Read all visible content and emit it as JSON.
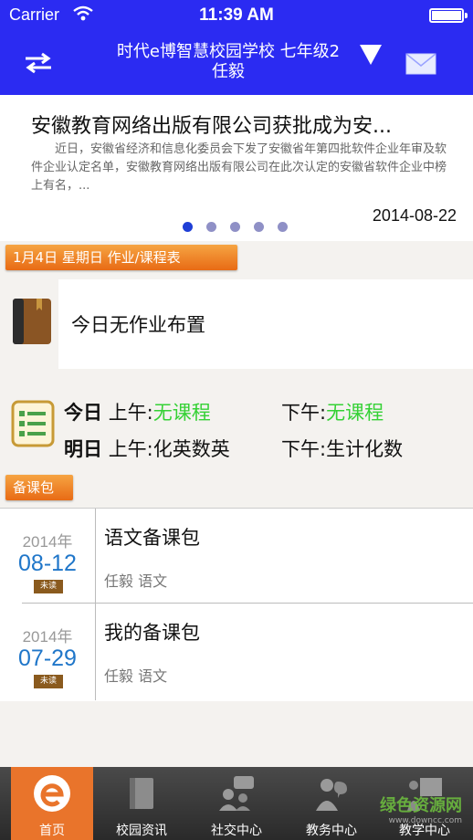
{
  "status_bar": {
    "carrier": "Carrier",
    "time": "11:39 AM"
  },
  "nav": {
    "title_line1": "时代e博智慧校园学校 七年级2",
    "title_line2": "任毅",
    "icons": [
      "switch-icon",
      "dropdown-triangle-icon",
      "mail-icon"
    ]
  },
  "news": {
    "title": "安徽教育网络出版有限公司获批成为安...",
    "body": "近日，安徽省经济和信息化委员会下发了安徽省年第四批软件企业年审及软件企业认定名单，安徽教育网络出版有限公司在此次认定的安徽省软件企业中榜上有名，...",
    "date": "2014-08-22",
    "page_count": 5,
    "active_page": 1
  },
  "schedule_tab": {
    "label": "1月4日 星期日 作业/课程表"
  },
  "homework": {
    "text": "今日无作业布置"
  },
  "schedule": {
    "today_label": "今日",
    "tomorrow_label": "明日",
    "am_prefix": "上午:",
    "pm_prefix": "下午:",
    "today_am": "无课程",
    "today_pm": "无课程",
    "tomorrow_am": "化英数英",
    "tomorrow_pm": "生计化数"
  },
  "prep_tab": {
    "label": "备课包"
  },
  "packages": [
    {
      "year": "2014年",
      "date": "08-12",
      "status": "未读",
      "title": "语文备课包",
      "meta": "任毅 语文"
    },
    {
      "year": "2014年",
      "date": "07-29",
      "status": "未读",
      "title": "我的备课包",
      "meta": "任毅 语文"
    }
  ],
  "tabs": [
    {
      "label": "首页",
      "icon": "home-e-icon",
      "active": true
    },
    {
      "label": "校园资讯",
      "icon": "book-icon",
      "active": false
    },
    {
      "label": "社交中心",
      "icon": "people-chat-icon",
      "active": false
    },
    {
      "label": "教务中心",
      "icon": "teacher-icon",
      "active": false
    },
    {
      "label": "教学中心",
      "icon": "presenter-icon",
      "active": false
    }
  ],
  "watermark": {
    "text": "绿色资源网",
    "sub": "www.downcc.com"
  },
  "colors": {
    "header": "#2b2bf2",
    "accent": "#e9742b",
    "date_blue": "#1f76c9",
    "no_class_green": "#35d135"
  }
}
